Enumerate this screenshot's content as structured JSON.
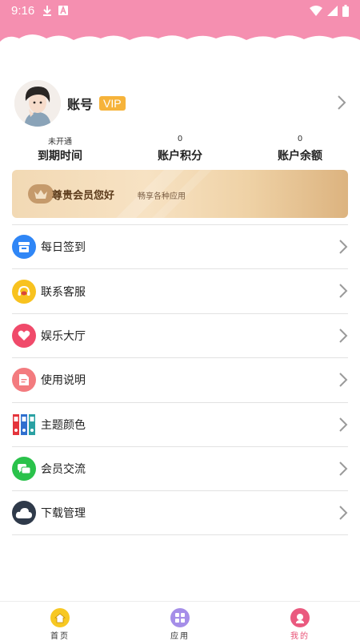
{
  "status_bar": {
    "time": "9:16"
  },
  "profile": {
    "account_label": "账号",
    "vip_badge": "VIP"
  },
  "stats": [
    {
      "value": "未开通",
      "label": "到期时间"
    },
    {
      "value": "0",
      "label": "账户积分"
    },
    {
      "value": "0",
      "label": "账户余额"
    }
  ],
  "vip_card": {
    "title": "尊贵会员您好",
    "subtitle": "畅享各种应用"
  },
  "menu": [
    {
      "label": "每日签到",
      "icon": "calendar-icon",
      "color": "#2f86f6"
    },
    {
      "label": "联系客服",
      "icon": "headset-icon",
      "color": "#f8c21f"
    },
    {
      "label": "娱乐大厅",
      "icon": "heart-icon",
      "color": "#f04a6a"
    },
    {
      "label": "使用说明",
      "icon": "document-icon",
      "color": "#f37b7f"
    },
    {
      "label": "主题颜色",
      "icon": "binders-icon",
      "color": "#e4343c"
    },
    {
      "label": "会员交流",
      "icon": "chat-icon",
      "color": "#2ac24b"
    },
    {
      "label": "下载管理",
      "icon": "cloud-icon",
      "color": "#2f3a4a"
    }
  ],
  "bottom_nav": [
    {
      "label": "首页",
      "icon": "home-icon",
      "color": "#f7c823"
    },
    {
      "label": "应用",
      "icon": "apps-icon",
      "color": "#a58ee8"
    },
    {
      "label": "我的",
      "icon": "profile-icon",
      "color": "#ea5a7f"
    }
  ],
  "colors": {
    "header": "#f58fb0",
    "vip_badge": "#f6b33a",
    "active_nav": "#e84f74"
  }
}
